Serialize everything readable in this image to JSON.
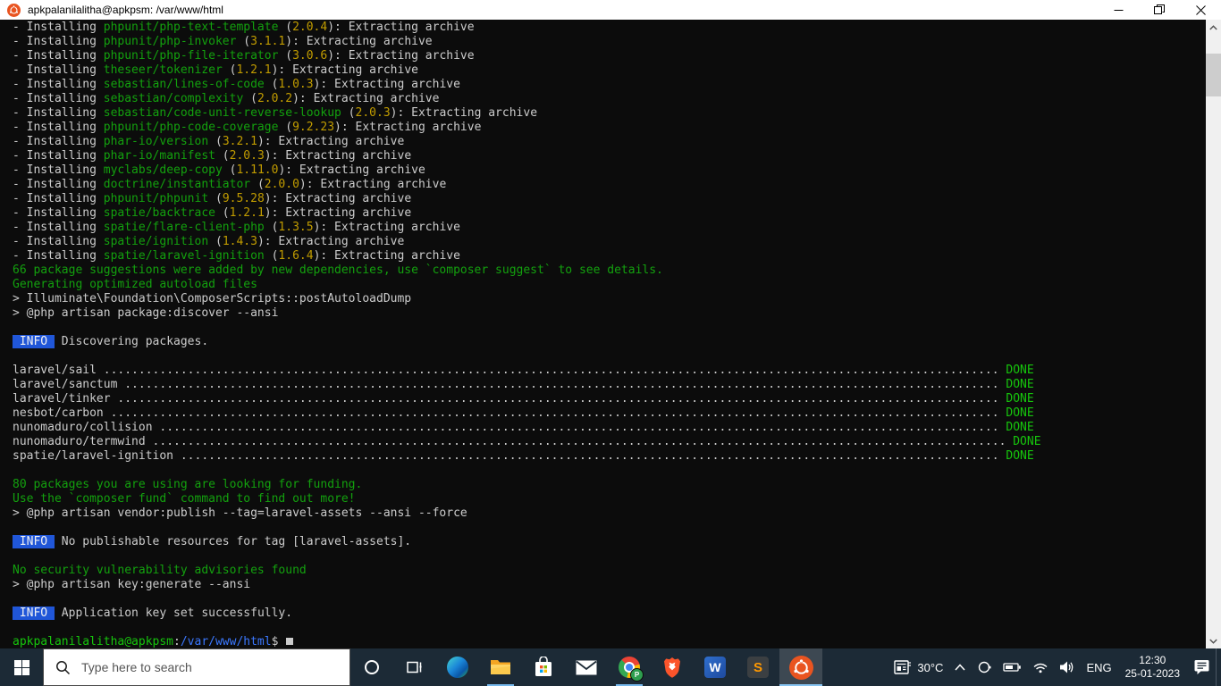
{
  "window": {
    "title": "apkpalanilalitha@apkpsm: /var/www/html",
    "icon": "ubuntu-logo"
  },
  "colors": {
    "terminal_bg": "#0c0c0c",
    "terminal_fg": "#cccccc",
    "green": "#13a10e",
    "bright_green": "#16c60c",
    "yellow": "#c19c00",
    "blue": "#3b78ff",
    "info_badge_bg": "#2056d8",
    "taskbar_bg": "#1c2a36",
    "underline_accent": "#76b9ed"
  },
  "terminal": {
    "labels": {
      "install_prefix": "- Installing ",
      "ver_open": " (",
      "ver_close": "): Extracting archive",
      "info_label": "INFO",
      "done_label": "DONE"
    },
    "prompt": {
      "user": "apkpalanilalitha@apkpsm",
      "colon": ":",
      "path": "/var/www/html",
      "symbol": "$"
    },
    "lines": [
      {
        "t": "install",
        "pkg": "phpunit/php-text-template",
        "ver": "2.0.4"
      },
      {
        "t": "install",
        "pkg": "phpunit/php-invoker",
        "ver": "3.1.1"
      },
      {
        "t": "install",
        "pkg": "phpunit/php-file-iterator",
        "ver": "3.0.6"
      },
      {
        "t": "install",
        "pkg": "theseer/tokenizer",
        "ver": "1.2.1"
      },
      {
        "t": "install",
        "pkg": "sebastian/lines-of-code",
        "ver": "1.0.3"
      },
      {
        "t": "install",
        "pkg": "sebastian/complexity",
        "ver": "2.0.2"
      },
      {
        "t": "install",
        "pkg": "sebastian/code-unit-reverse-lookup",
        "ver": "2.0.3"
      },
      {
        "t": "install",
        "pkg": "phpunit/php-code-coverage",
        "ver": "9.2.23"
      },
      {
        "t": "install",
        "pkg": "phar-io/version",
        "ver": "3.2.1"
      },
      {
        "t": "install",
        "pkg": "phar-io/manifest",
        "ver": "2.0.3"
      },
      {
        "t": "install",
        "pkg": "myclabs/deep-copy",
        "ver": "1.11.0"
      },
      {
        "t": "install",
        "pkg": "doctrine/instantiator",
        "ver": "2.0.0"
      },
      {
        "t": "install",
        "pkg": "phpunit/phpunit",
        "ver": "9.5.28"
      },
      {
        "t": "install",
        "pkg": "spatie/backtrace",
        "ver": "1.2.1"
      },
      {
        "t": "install",
        "pkg": "spatie/flare-client-php",
        "ver": "1.3.5"
      },
      {
        "t": "install",
        "pkg": "spatie/ignition",
        "ver": "1.4.3"
      },
      {
        "t": "install",
        "pkg": "spatie/laravel-ignition",
        "ver": "1.6.4"
      },
      {
        "t": "seg",
        "s": [
          [
            "g",
            "66 package suggestions were added by new dependencies, use `composer suggest` to see details."
          ]
        ]
      },
      {
        "t": "seg",
        "s": [
          [
            "g",
            "Generating optimized autoload files"
          ]
        ]
      },
      {
        "t": "seg",
        "s": [
          [
            "w",
            "> Illuminate\\Foundation\\ComposerScripts::postAutoloadDump"
          ]
        ]
      },
      {
        "t": "seg",
        "s": [
          [
            "w",
            "> @php artisan package:discover --ansi"
          ]
        ]
      },
      {
        "t": "blank"
      },
      {
        "t": "info",
        "text": "Discovering packages."
      },
      {
        "t": "blank"
      },
      {
        "t": "discover",
        "pkg": "laravel/sail",
        "dots": 128
      },
      {
        "t": "discover",
        "pkg": "laravel/sanctum",
        "dots": 125
      },
      {
        "t": "discover",
        "pkg": "laravel/tinker",
        "dots": 126
      },
      {
        "t": "discover",
        "pkg": "nesbot/carbon",
        "dots": 127
      },
      {
        "t": "discover",
        "pkg": "nunomaduro/collision",
        "dots": 120
      },
      {
        "t": "discover",
        "pkg": "nunomaduro/termwind",
        "dots": 122
      },
      {
        "t": "discover",
        "pkg": "spatie/laravel-ignition",
        "dots": 117
      },
      {
        "t": "blank"
      },
      {
        "t": "seg",
        "s": [
          [
            "g",
            "80 packages you are using are looking for funding."
          ]
        ]
      },
      {
        "t": "seg",
        "s": [
          [
            "g",
            "Use the `composer fund` command to find out more!"
          ]
        ]
      },
      {
        "t": "seg",
        "s": [
          [
            "w",
            "> @php artisan vendor:publish --tag=laravel-assets --ansi --force"
          ]
        ]
      },
      {
        "t": "blank"
      },
      {
        "t": "info",
        "text": "No publishable resources for tag [laravel-assets]."
      },
      {
        "t": "blank"
      },
      {
        "t": "seg",
        "s": [
          [
            "g",
            "No security vulnerability advisories found"
          ]
        ]
      },
      {
        "t": "seg",
        "s": [
          [
            "w",
            "> @php artisan key:generate --ansi"
          ]
        ]
      },
      {
        "t": "blank"
      },
      {
        "t": "info",
        "text": "Application key set successfully."
      },
      {
        "t": "blank"
      },
      {
        "t": "prompt"
      }
    ]
  },
  "taskbar": {
    "search_placeholder": "Type here to search",
    "chrome_badge": "P",
    "word_letter": "W",
    "sublime_letter": "S",
    "apps": [
      "start",
      "search",
      "cortana",
      "task-view",
      "edge",
      "file-explorer",
      "microsoft-store",
      "mail",
      "chrome",
      "brave",
      "word",
      "sublime-text",
      "ubuntu-terminal"
    ],
    "running_apps": [
      "file-explorer",
      "chrome",
      "ubuntu-terminal"
    ],
    "active_app": "ubuntu-terminal",
    "tray": {
      "temperature": "30°C",
      "language": "ENG",
      "time": "12:30",
      "date": "25-01-2023"
    }
  }
}
